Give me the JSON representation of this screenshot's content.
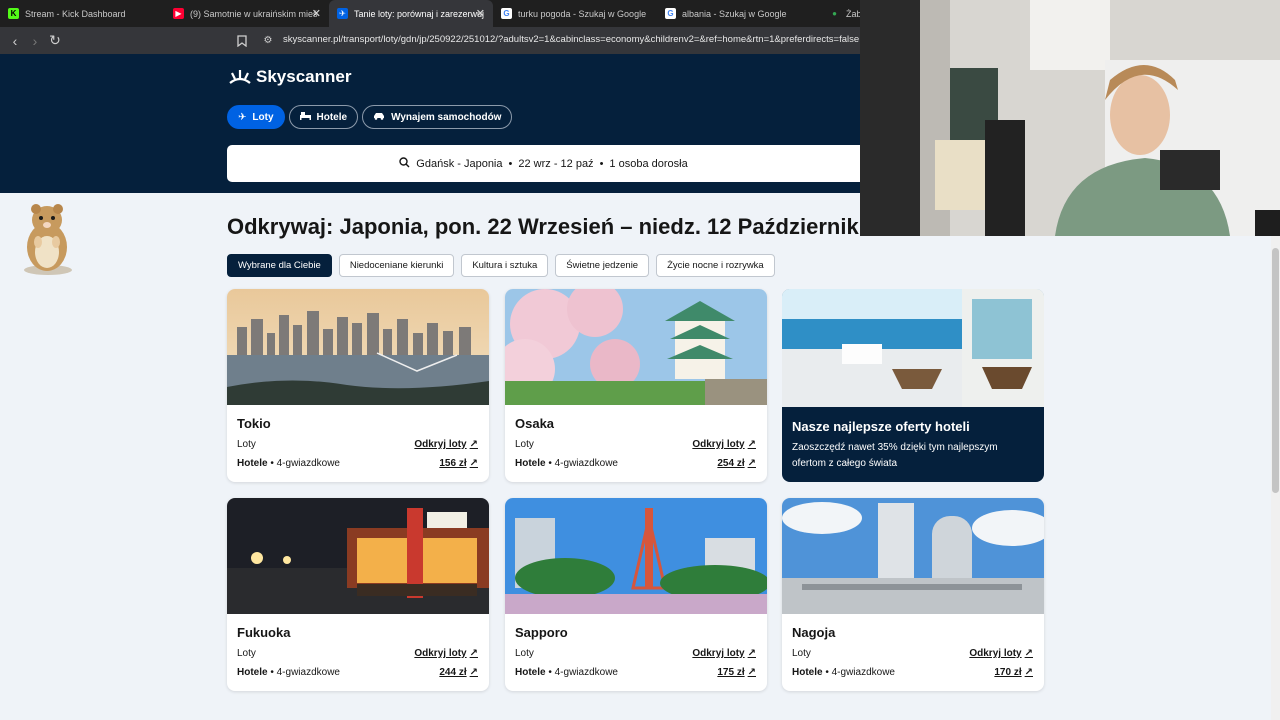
{
  "browser": {
    "tabs": [
      {
        "title": "Stream - Kick Dashboard",
        "active": false,
        "favicon_color": "#53fc18",
        "favicon_glyph": "K"
      },
      {
        "title": "(9) Samotnie w ukraińskim mieś",
        "active": false,
        "favicon_color": "#ff0033",
        "favicon_glyph": "▶"
      },
      {
        "title": "Tanie loty: porównaj i zarezerwuj",
        "active": true,
        "favicon_color": "#0062e3",
        "favicon_glyph": "✈"
      },
      {
        "title": "turku pogoda - Szukaj w Google",
        "active": false,
        "favicon_color": "#ffffff",
        "favicon_glyph": "G"
      },
      {
        "title": "albania - Szukaj w Google",
        "active": false,
        "favicon_color": "#ffffff",
        "favicon_glyph": "G"
      },
      {
        "title": "Żab",
        "active": false,
        "favicon_color": "#34a853",
        "favicon_glyph": "●"
      }
    ],
    "url": "skyscanner.pl/transport/loty/gdn/jp/250922/251012/?adultsv2=1&cabinclass=economy&childrenv2=&ref=home&rtn=1&preferdirects=false"
  },
  "header": {
    "logo_text": "Skyscanner",
    "nav": [
      {
        "label": "Loty",
        "icon": "plane-icon",
        "active": true
      },
      {
        "label": "Hotele",
        "icon": "bed-icon",
        "active": false
      },
      {
        "label": "Wynajem samochodów",
        "icon": "car-icon",
        "active": false
      }
    ],
    "search_summary": {
      "route": "Gdańsk - Japonia",
      "dates": "22 wrz - 12 paź",
      "travellers": "1 osoba dorosła"
    }
  },
  "main": {
    "title": "Odkrywaj: Japonia, pon. 22 Wrzesień – niedz. 12 Październik",
    "filters": [
      {
        "label": "Wybrane dla Ciebie",
        "active": true
      },
      {
        "label": "Niedoceniane kierunki",
        "active": false
      },
      {
        "label": "Kultura i sztuka",
        "active": false
      },
      {
        "label": "Świetne jedzenie",
        "active": false
      },
      {
        "label": "Życie nocne i rozrywka",
        "active": false
      }
    ],
    "cards": [
      {
        "city": "Tokio",
        "flights_label": "Loty",
        "flights_link": "Odkryj loty",
        "hotels_label": "Hotele",
        "hotels_suffix": " • 4-gwiazdkowe",
        "hotels_price": "156 zł"
      },
      {
        "city": "Osaka",
        "flights_label": "Loty",
        "flights_link": "Odkryj loty",
        "hotels_label": "Hotele",
        "hotels_suffix": " • 4-gwiazdkowe",
        "hotels_price": "254 zł"
      },
      {
        "city": "Fukuoka",
        "flights_label": "Loty",
        "flights_link": "Odkryj loty",
        "hotels_label": "Hotele",
        "hotels_suffix": " • 4-gwiazdkowe",
        "hotels_price": "244 zł"
      },
      {
        "city": "Sapporo",
        "flights_label": "Loty",
        "flights_link": "Odkryj loty",
        "hotels_label": "Hotele",
        "hotels_suffix": " • 4-gwiazdkowe",
        "hotels_price": "175 zł"
      },
      {
        "city": "Nagoja",
        "flights_label": "Loty",
        "flights_link": "Odkryj loty",
        "hotels_label": "Hotele",
        "hotels_suffix": " • 4-gwiazdkowe",
        "hotels_price": "170 zł"
      }
    ],
    "promo": {
      "title": "Nasze najlepsze oferty hoteli",
      "text": "Zaoszczędź nawet 35% dzięki tym najlepszym ofertom z całego świata"
    }
  },
  "colors": {
    "brand_dark": "#05203c",
    "brand_blue": "#0062e3",
    "page_bg": "#eff3f8"
  }
}
